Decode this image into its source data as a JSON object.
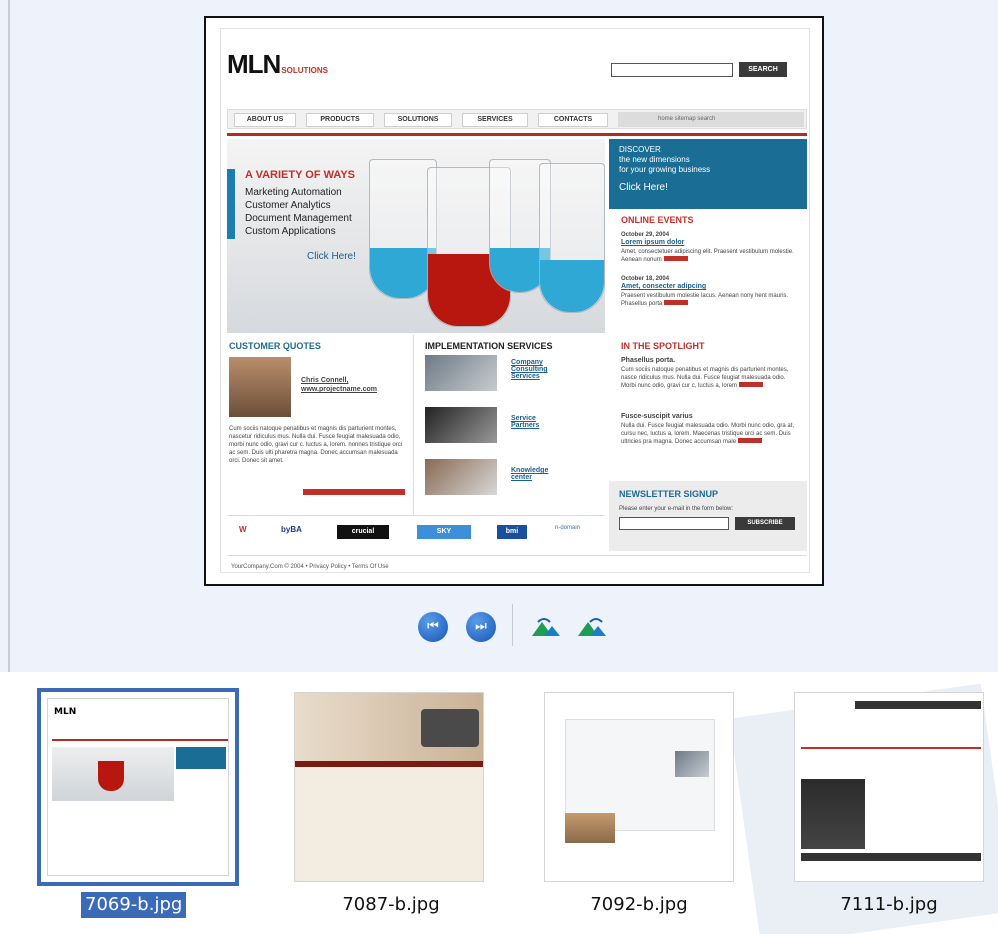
{
  "preview": {
    "site": {
      "logo": "MLN",
      "logo_sub": "SOLUTIONS",
      "search_button": "SEARCH",
      "nav": [
        "ABOUT US",
        "PRODUCTS",
        "SOLUTIONS",
        "SERVICES",
        "CONTACTS"
      ],
      "nav_util": "home  sitemap  search",
      "hero": {
        "title": "A VARIETY OF WAYS",
        "lines": [
          "Marketing Automation",
          "Customer Analytics",
          "Document Management",
          "Custom Applications"
        ],
        "click": "Click Here!"
      },
      "discover": {
        "lines": [
          "DISCOVER",
          "the new dimensions",
          "for your growing business"
        ],
        "click": "Click Here!"
      },
      "online_events": {
        "title": "ONLINE EVENTS",
        "items": [
          {
            "date": "October 29, 2004",
            "heading": "Lorem ipsum dolor",
            "text": "Amet, consectetuer adipiscing elit. Praesent vestibulum molestie. Aenean nonum"
          },
          {
            "date": "October 18, 2004",
            "heading": "Amet, consecter adipcing",
            "text": "Praesent vestibulum molestie lacus. Aenean nony hent mauris. Phasellus porta"
          }
        ]
      },
      "customer_quotes": {
        "title": "CUSTOMER QUOTES",
        "name": "Chris Connell,",
        "site": "www.projectname.com",
        "quote": "Cum sociis natoque penatibus et magnis dis parturient montes, nascetur ridiculus mus. Nulla dui. Fusce feugiat malesuada odio, morbi nunc odio, gravi cur c. luctus a, lorem. nonnes tristique orci ac sem. Duis ulti pharetra magna. Donec accumsan malesuada orci. Donec sit amet."
      },
      "implementation": {
        "title": "IMPLEMENTATION SERVICES",
        "links": [
          "Company Consulting Services",
          "Service Partners",
          "Knowledge center"
        ]
      },
      "spotlight": {
        "title": "IN THE SPOTLIGHT",
        "items": [
          {
            "heading": "Phasellus porta.",
            "text": "Cum sociis natoque penatibus et magnis dis parturient montes, nasce ridiculus mus. Nulla dui. Fusce feugiat malesuada odio. Morbi nunc odio, gravi cur c, luctus a, lorem"
          },
          {
            "heading": "Fusce-suscipit varius",
            "text": "Nulla dui. Fusce feugiat malesuada odio. Morbi nunc odio, gra at, cursu nec, luctus a, lorem. Maecenas tristique orci ac sem. Duis ultricies pra magna. Donec accumsan male"
          }
        ]
      },
      "newsletter": {
        "title": "NEWSLETTER SIGNUP",
        "prompt": "Please enter your e-mail in the form below:",
        "button": "SUBSCRIBE"
      },
      "partners": [
        "W",
        "byBA",
        "crucial",
        "SKY",
        "bmi",
        "n-domain"
      ],
      "footer": "YourCompany.Com © 2004 • Privacy Policy • Terms Of Use"
    }
  },
  "controls": {
    "prev_icon": "previous-image-icon",
    "next_icon": "next-image-icon",
    "rotate_cw_icon": "rotate-clockwise-icon",
    "rotate_ccw_icon": "rotate-counterclockwise-icon"
  },
  "thumbnails": [
    {
      "filename": "7069-b.jpg",
      "selected": true
    },
    {
      "filename": "7087-b.jpg",
      "selected": false
    },
    {
      "filename": "7092-b.jpg",
      "selected": false
    },
    {
      "filename": "7111-b.jpg",
      "selected": false
    }
  ],
  "colors": {
    "selection": "#3a6ab8",
    "background": "#eef2fb",
    "accent_red": "#c0302b",
    "accent_blue": "#1a6d95"
  }
}
